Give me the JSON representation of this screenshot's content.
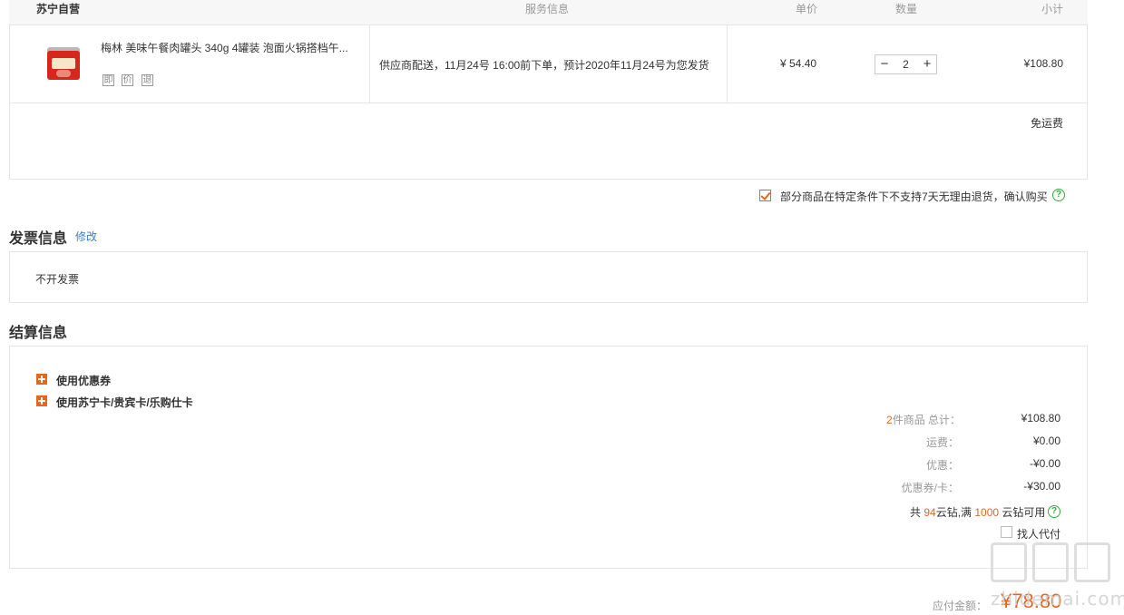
{
  "order": {
    "store_name": "苏宁自营",
    "headers": {
      "service": "服务信息",
      "unit_price": "单价",
      "quantity": "数量",
      "subtotal": "小计"
    },
    "product": {
      "title": "梅林 美味午餐肉罐头 340g 4罐装 泡面火锅搭档午...",
      "service_icons": [
        "即",
        "价",
        "退"
      ],
      "service_info": "供应商配送，11月24号 16:00前下单，预计2020年11月24号为您发货",
      "unit_price": "¥ 54.40",
      "quantity": "2",
      "qty_minus": "−",
      "qty_plus": "+",
      "subtotal": "¥108.80"
    },
    "shipping_note": "免运费"
  },
  "confirm": {
    "checked": true,
    "text": "部分商品在特定条件下不支持7天无理由退货，确认购买",
    "help": "?"
  },
  "invoice": {
    "title": "发票信息",
    "edit_label": "修改",
    "value": "不开发票"
  },
  "settlement": {
    "title": "结算信息",
    "options": [
      "使用优惠券",
      "使用苏宁卡/贵宾卡/乐购仕卡"
    ],
    "summary": {
      "count": "2",
      "count_suffix": "件商品 总计：",
      "total": "¥108.80",
      "shipping_label": "运费：",
      "shipping": "¥0.00",
      "discount_label": "优惠：",
      "discount": "-¥0.00",
      "coupon_label": "优惠券/卡：",
      "coupon": "-¥30.00"
    },
    "diamonds": {
      "prefix": "共 ",
      "count": "94",
      "mid": "云钻,满 ",
      "min": "1000",
      "suffix": " 云钻可用",
      "help": "?"
    },
    "proxy_pay": "找人代付"
  },
  "payable": {
    "label": "应付金额：",
    "amount": "¥78.80"
  },
  "watermark": {
    "text": "zhidemai.com"
  },
  "colors": {
    "accent": "#e8661c",
    "link": "#3a7fd5",
    "help": "#3aa93a",
    "border": "#e6e6e6"
  }
}
